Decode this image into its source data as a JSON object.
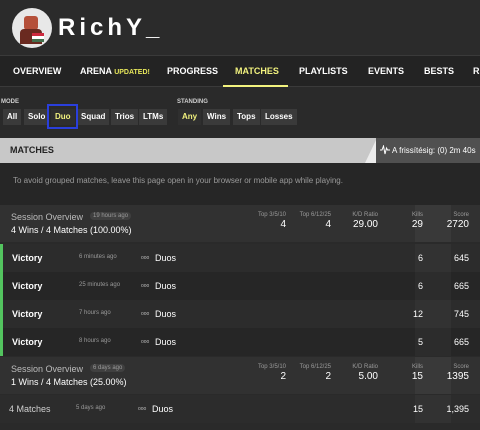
{
  "profile": {
    "username": "RichY_"
  },
  "nav": {
    "items": [
      {
        "label": "OVERVIEW"
      },
      {
        "label": "ARENA",
        "badge": "UPDATED!"
      },
      {
        "label": "PROGRESS"
      },
      {
        "label": "MATCHES",
        "active": true
      },
      {
        "label": "PLAYLISTS"
      },
      {
        "label": "EVENTS"
      },
      {
        "label": "BESTS"
      },
      {
        "label": "R"
      }
    ]
  },
  "filters": {
    "mode_label": "MODE",
    "modes": [
      "All",
      "Solo",
      "Duo",
      "Squad",
      "Trios",
      "LTMs"
    ],
    "selected_mode": "Duo",
    "standing_label": "STANDING",
    "standings": [
      "Any",
      "Wins",
      "Tops",
      "Losses"
    ],
    "selected_standing": "Any"
  },
  "matches_header": {
    "title": "MATCHES",
    "refresh": "A frissítésig: (0) 2m 40s"
  },
  "info": "To avoid grouped matches, leave this page open in your browser or mobile app while playing.",
  "sessions": [
    {
      "title": "Session Overview",
      "ago": "19 hours ago",
      "summary": "4 Wins / 4 Matches (100.00%)",
      "top1_label": "Top 3/5/10",
      "top1": "4",
      "top2_label": "Top 6/12/25",
      "top2": "4",
      "kd_label": "K/D Ratio",
      "kd": "29.00",
      "kills_label": "Kills",
      "kills": "29",
      "score_label": "Score",
      "score": "2720"
    },
    {
      "title": "Session Overview",
      "ago": "6 days ago",
      "summary": "1 Wins / 4 Matches (25.00%)",
      "top1_label": "Top 3/5/10",
      "top1": "2",
      "top2_label": "Top 6/12/25",
      "top2": "2",
      "kd_label": "K/D Ratio",
      "kd": "5.00",
      "kills_label": "Kills",
      "kills": "15",
      "score_label": "Score",
      "score": "1395"
    }
  ],
  "rows": [
    {
      "title": "Victory",
      "time": "6 minutes ago",
      "mode_icon": "ooo",
      "mode": "Duos",
      "kills": "6",
      "score": "645"
    },
    {
      "title": "Victory",
      "time": "25 minutes ago",
      "mode_icon": "ooo",
      "mode": "Duos",
      "kills": "6",
      "score": "665"
    },
    {
      "title": "Victory",
      "time": "7 hours ago",
      "mode_icon": "ooo",
      "mode": "Duos",
      "kills": "12",
      "score": "745"
    },
    {
      "title": "Victory",
      "time": "8 hours ago",
      "mode_icon": "ooo",
      "mode": "Duos",
      "kills": "5",
      "score": "665"
    },
    {
      "title": "4 Matches",
      "time": "5 days ago",
      "mode_icon": "ooo",
      "mode": "Duos",
      "kills": "15",
      "score": "1,395"
    }
  ],
  "colors": {
    "accent": "#f2f27e",
    "win": "#53c45f",
    "highlight": "#2a3fdc"
  }
}
